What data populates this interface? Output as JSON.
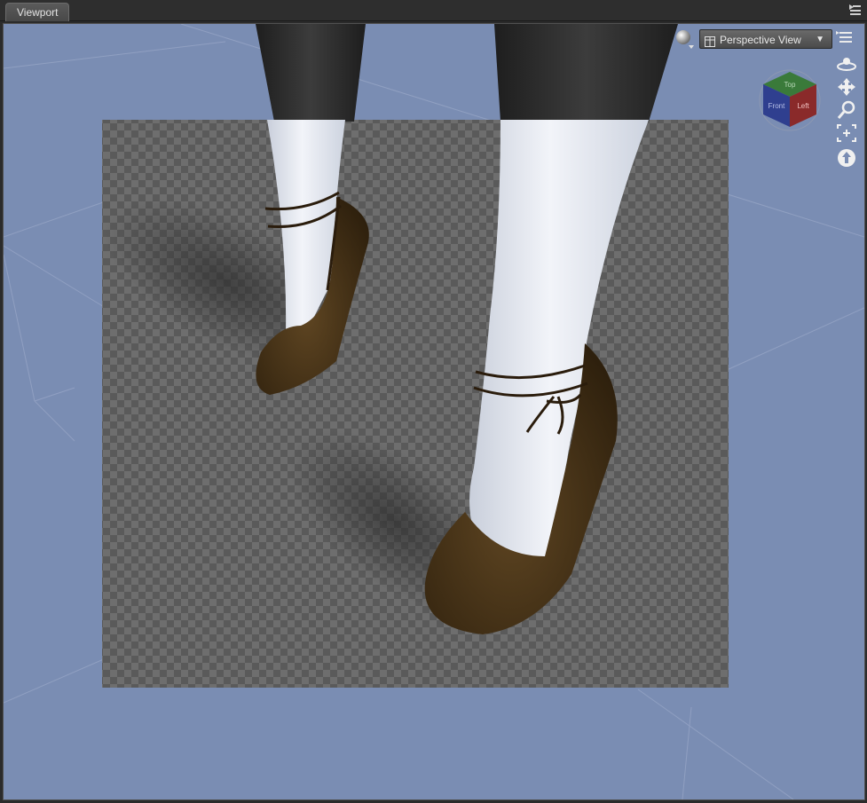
{
  "panel": {
    "tab_label": "Viewport",
    "menu_icon": "panel-options-icon"
  },
  "toolbar": {
    "view_selector_label": "Perspective View",
    "view_selector_icon": "viewport-layout-icon",
    "shading_icon": "draw-style-sphere-icon"
  },
  "view_cube": {
    "faces": [
      "Top",
      "Front",
      "Left"
    ],
    "colors": {
      "top": "#3a7a3a",
      "front": "#2f3f8f",
      "left": "#8a2a2a"
    }
  },
  "nav_tools": [
    {
      "name": "orbit-icon"
    },
    {
      "name": "pan-icon"
    },
    {
      "name": "zoom-icon"
    },
    {
      "name": "frame-icon"
    },
    {
      "name": "reset-view-icon"
    }
  ],
  "colors": {
    "viewport_bg": "#7a8db3",
    "stockings": "#e8ecf4",
    "shoes": "#4a3418",
    "leggings_dark": "#2c2c2c"
  }
}
